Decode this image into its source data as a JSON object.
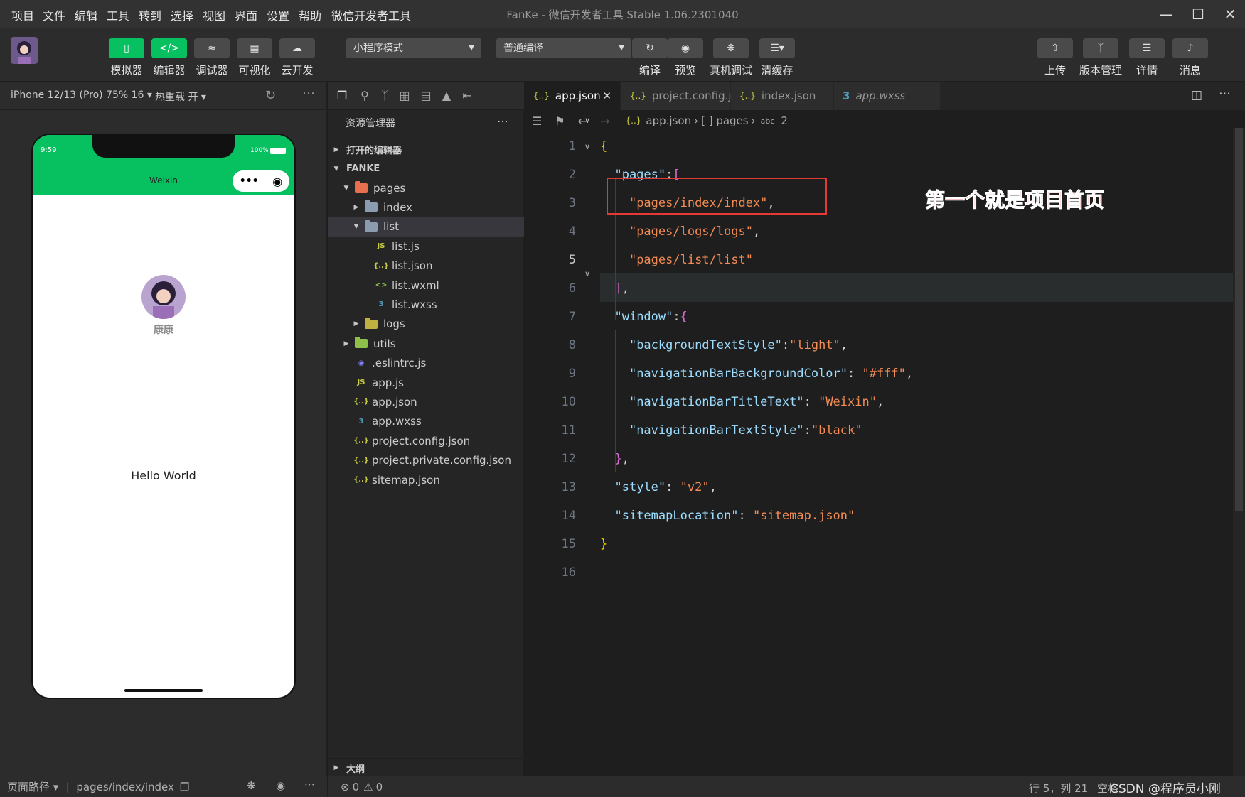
{
  "menubar": {
    "items": [
      "项目",
      "文件",
      "编辑",
      "工具",
      "转到",
      "选择",
      "视图",
      "界面",
      "设置",
      "帮助",
      "微信开发者工具"
    ],
    "title": "FanKe - 微信开发者工具 Stable 1.06.2301040"
  },
  "toolbar": {
    "left_buttons": [
      {
        "label": "模拟器",
        "icon": "phone-icon"
      },
      {
        "label": "编辑器",
        "icon": "code-icon"
      },
      {
        "label": "调试器",
        "icon": "debug-icon"
      },
      {
        "label": "可视化",
        "icon": "layout-icon"
      },
      {
        "label": "云开发",
        "icon": "cloud-icon"
      }
    ],
    "mode_select": "小程序模式",
    "compile_select": "普通编译",
    "center_buttons": [
      {
        "label": "编译",
        "icon": "refresh-icon"
      },
      {
        "label": "预览",
        "icon": "eye-icon"
      },
      {
        "label": "真机调试",
        "icon": "bug-icon"
      },
      {
        "label": "清缓存",
        "icon": "layers-icon"
      }
    ],
    "right_buttons": [
      {
        "label": "上传",
        "icon": "upload-icon"
      },
      {
        "label": "版本管理",
        "icon": "branch-icon"
      },
      {
        "label": "详情",
        "icon": "menu-icon"
      },
      {
        "label": "消息",
        "icon": "bell-icon"
      }
    ]
  },
  "simulator": {
    "device": "iPhone 12/13 (Pro) 75% 16",
    "hot_reload": "热重载 开",
    "time": "9:59",
    "battery": "100%",
    "nav_title": "Weixin",
    "username": "康康",
    "hello": "Hello World",
    "status_path_label": "页面路径",
    "status_path": "pages/index/index"
  },
  "explorer": {
    "title": "资源管理器",
    "open_editors": "打开的编辑器",
    "project": "FANKE",
    "outline": "大纲",
    "tree": [
      {
        "name": "pages",
        "type": "folder-open",
        "color": "#e8704e",
        "depth": 1
      },
      {
        "name": "index",
        "type": "folder",
        "color": "#8b9bb0",
        "depth": 2
      },
      {
        "name": "list",
        "type": "folder-open",
        "color": "#8b9bb0",
        "depth": 2,
        "selected": true
      },
      {
        "name": "list.js",
        "type": "js",
        "depth": 3
      },
      {
        "name": "list.json",
        "type": "json",
        "depth": 3
      },
      {
        "name": "list.wxml",
        "type": "wxml",
        "depth": 3
      },
      {
        "name": "list.wxss",
        "type": "css",
        "depth": 3
      },
      {
        "name": "logs",
        "type": "folder",
        "color": "#c0b240",
        "depth": 2
      },
      {
        "name": "utils",
        "type": "folder",
        "color": "#8dc149",
        "depth": 1
      },
      {
        "name": ".eslintrc.js",
        "type": "eslint",
        "depth": 1
      },
      {
        "name": "app.js",
        "type": "js",
        "depth": 1
      },
      {
        "name": "app.json",
        "type": "json",
        "depth": 1
      },
      {
        "name": "app.wxss",
        "type": "css",
        "depth": 1
      },
      {
        "name": "project.config.json",
        "type": "json",
        "depth": 1
      },
      {
        "name": "project.private.config.json",
        "type": "json",
        "depth": 1
      },
      {
        "name": "sitemap.json",
        "type": "json",
        "depth": 1
      }
    ]
  },
  "editor": {
    "tabs": [
      {
        "label": "app.json",
        "icon": "{..}",
        "active": true
      },
      {
        "label": "project.config.json",
        "icon": "{..}"
      },
      {
        "label": "index.json",
        "icon": "{..}"
      },
      {
        "label": "app.wxss",
        "icon": "css"
      }
    ],
    "breadcrumb": [
      "app.json",
      "[ ] pages",
      "2"
    ],
    "annotation": "第一个就是项目首页",
    "current_line": 5,
    "lines": [
      {
        "n": "1",
        "t": [
          [
            "b1",
            "{"
          ]
        ]
      },
      {
        "n": "2",
        "t": [
          [
            "p",
            "  "
          ],
          [
            "k",
            "\"pages\""
          ],
          [
            "p",
            ":"
          ],
          [
            "b2",
            "["
          ]
        ]
      },
      {
        "n": "3",
        "t": [
          [
            "p",
            "    "
          ],
          [
            "s",
            "\"pages/index/index\""
          ],
          [
            "p",
            ","
          ]
        ]
      },
      {
        "n": "4",
        "t": [
          [
            "p",
            "    "
          ],
          [
            "s",
            "\"pages/logs/logs\""
          ],
          [
            "p",
            ","
          ]
        ]
      },
      {
        "n": "5",
        "t": [
          [
            "p",
            "    "
          ],
          [
            "s",
            "\"pages/list/list\""
          ]
        ]
      },
      {
        "n": "6",
        "t": [
          [
            "p",
            "  "
          ],
          [
            "b2",
            "]"
          ],
          [
            "p",
            ","
          ]
        ]
      },
      {
        "n": "7",
        "t": [
          [
            "p",
            "  "
          ],
          [
            "k",
            "\"window\""
          ],
          [
            "p",
            ":"
          ],
          [
            "b2",
            "{"
          ]
        ]
      },
      {
        "n": "8",
        "t": [
          [
            "p",
            "    "
          ],
          [
            "k",
            "\"backgroundTextStyle\""
          ],
          [
            "p",
            ":"
          ],
          [
            "s",
            "\"light\""
          ],
          [
            "p",
            ","
          ]
        ]
      },
      {
        "n": "9",
        "t": [
          [
            "p",
            "    "
          ],
          [
            "k",
            "\"navigationBarBackgroundColor\""
          ],
          [
            "p",
            ": "
          ],
          [
            "s",
            "\"#fff\""
          ],
          [
            "p",
            ","
          ]
        ]
      },
      {
        "n": "10",
        "t": [
          [
            "p",
            "    "
          ],
          [
            "k",
            "\"navigationBarTitleText\""
          ],
          [
            "p",
            ": "
          ],
          [
            "s",
            "\"Weixin\""
          ],
          [
            "p",
            ","
          ]
        ]
      },
      {
        "n": "11",
        "t": [
          [
            "p",
            "    "
          ],
          [
            "k",
            "\"navigationBarTextStyle\""
          ],
          [
            "p",
            ":"
          ],
          [
            "s",
            "\"black\""
          ]
        ]
      },
      {
        "n": "12",
        "t": [
          [
            "p",
            "  "
          ],
          [
            "b2",
            "}"
          ],
          [
            "p",
            ","
          ]
        ]
      },
      {
        "n": "13",
        "t": [
          [
            "p",
            "  "
          ],
          [
            "k",
            "\"style\""
          ],
          [
            "p",
            ": "
          ],
          [
            "s",
            "\"v2\""
          ],
          [
            "p",
            ","
          ]
        ]
      },
      {
        "n": "14",
        "t": [
          [
            "p",
            "  "
          ],
          [
            "k",
            "\"sitemapLocation\""
          ],
          [
            "p",
            ": "
          ],
          [
            "s",
            "\"sitemap.json\""
          ]
        ]
      },
      {
        "n": "15",
        "t": [
          [
            "b1",
            "}"
          ]
        ]
      },
      {
        "n": "16",
        "t": []
      }
    ]
  },
  "statusbar": {
    "errors": "0",
    "warnings": "0",
    "cursor": "行 5，列 21",
    "spaces": "空格",
    "watermark": "CSDN @程序员小刚"
  },
  "colors": {
    "accent": "#07c160",
    "annotation_red": "#e53935"
  }
}
